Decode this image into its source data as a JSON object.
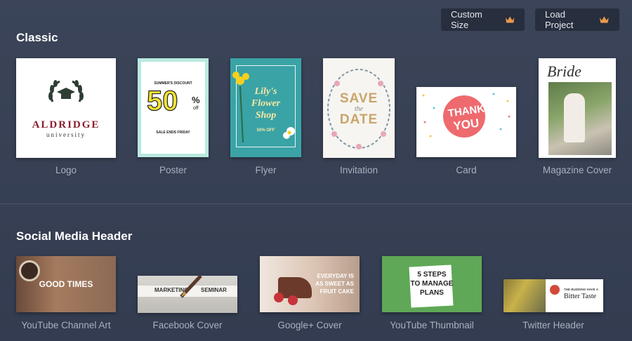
{
  "toolbar": {
    "custom_size_label": "Custom Size",
    "load_project_label": "Load Project"
  },
  "sections": {
    "classic": {
      "title": "Classic",
      "items": [
        {
          "label": "Logo",
          "thumb": {
            "brand": "ALDRIDGE",
            "sub": "university"
          }
        },
        {
          "label": "Poster",
          "thumb": {
            "headline": "SUMMER'S DISCOUNT",
            "big": "50",
            "pct": "%",
            "off": "off",
            "foot": "SALE ENDS FRIDAY"
          }
        },
        {
          "label": "Flyer",
          "thumb": {
            "l1": "Lily's",
            "l2": "Flower",
            "l3": "Shop",
            "promo": "50% OFF"
          }
        },
        {
          "label": "Invitation",
          "thumb": {
            "l1": "SAVE",
            "l2": "the",
            "l3": "DATE"
          }
        },
        {
          "label": "Card",
          "thumb": {
            "l1": "THANK",
            "l2": "YOU"
          }
        },
        {
          "label": "Magazine Cover",
          "thumb": {
            "title": "Bride"
          }
        }
      ]
    },
    "social": {
      "title": "Social Media Header",
      "items": [
        {
          "label": "YouTube Channel Art",
          "thumb": {
            "text": "GOOD TIMES"
          }
        },
        {
          "label": "Facebook Cover",
          "thumb": {
            "left": "MARKETING",
            "right": "SEMINAR"
          }
        },
        {
          "label": "Google+ Cover",
          "thumb": {
            "l1": "EVERYDAY IS",
            "l2": "AS SWEET AS",
            "l3": "FRUIT CAKE"
          }
        },
        {
          "label": "YouTube Thumbnail",
          "thumb": {
            "l1": "5 STEPS",
            "l2": "TO MANAGE",
            "l3": "PLANS"
          }
        },
        {
          "label": "Twitter Header",
          "thumb": {
            "l1": "THE BUDDING HAVE A",
            "l2": "Bitter Taste"
          }
        }
      ]
    }
  },
  "colors": {
    "crown": "#e89a4a",
    "poster_yellow": "#f2e233",
    "flyer_teal": "#3aa3a6",
    "card_pink": "#ee6a6e",
    "yt_green": "#5fa857"
  }
}
